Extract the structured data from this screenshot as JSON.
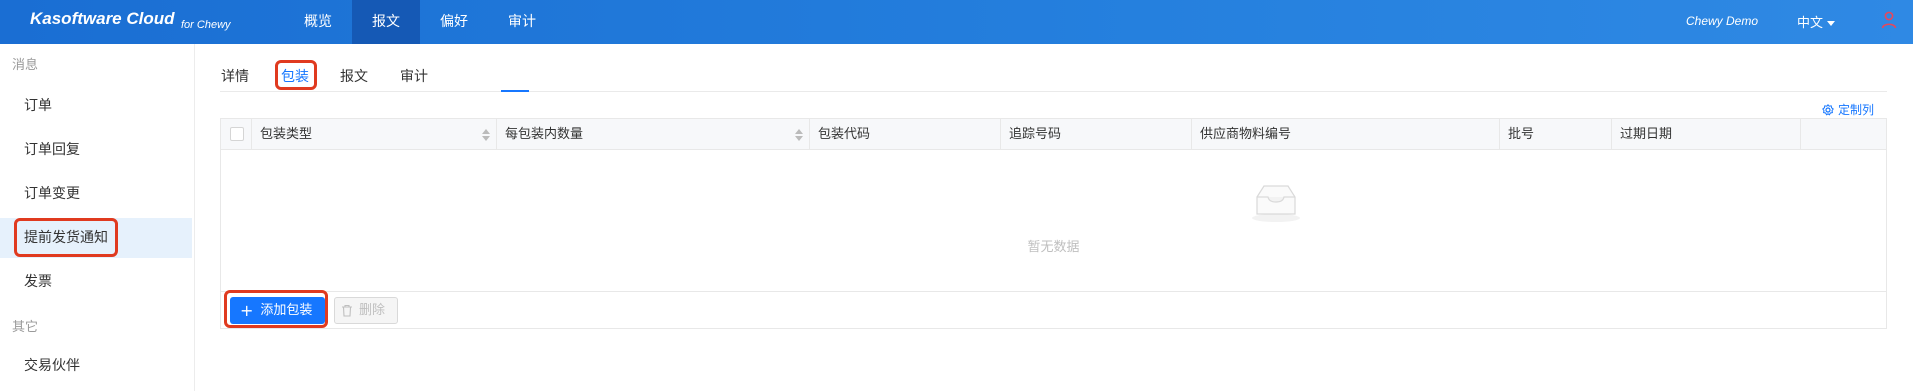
{
  "header": {
    "brand": "Kasoftware Cloud",
    "brand_sub": "for Chewy",
    "nav": [
      "概览",
      "报文",
      "偏好",
      "审计"
    ],
    "active_nav": "报文",
    "user": "Chewy Demo",
    "language": "中文",
    "user_icon": "user-icon"
  },
  "sidebar": {
    "group1": "消息",
    "items": [
      "订单",
      "订单回复",
      "订单变更",
      "提前发货通知",
      "发票"
    ],
    "active_item": "提前发货通知",
    "group2": "其它",
    "items2": [
      "交易伙伴"
    ]
  },
  "tabs": {
    "items": [
      "详情",
      "包装",
      "报文",
      "审计"
    ],
    "active": "包装"
  },
  "customize_label": "定制列",
  "table": {
    "columns": [
      "包装类型",
      "每包装内数量",
      "包装代码",
      "追踪号码",
      "供应商物料编号",
      "批号",
      "过期日期"
    ],
    "empty_text": "暂无数据",
    "add_button": "添加包装",
    "delete_button": "删除"
  },
  "colors": {
    "header_bg": "#2080de",
    "active_nav_bg": "#1559b5",
    "primary": "#1677ff",
    "highlight_box": "#e03a1f",
    "sidebar_active_bg": "#e6f1fc"
  }
}
